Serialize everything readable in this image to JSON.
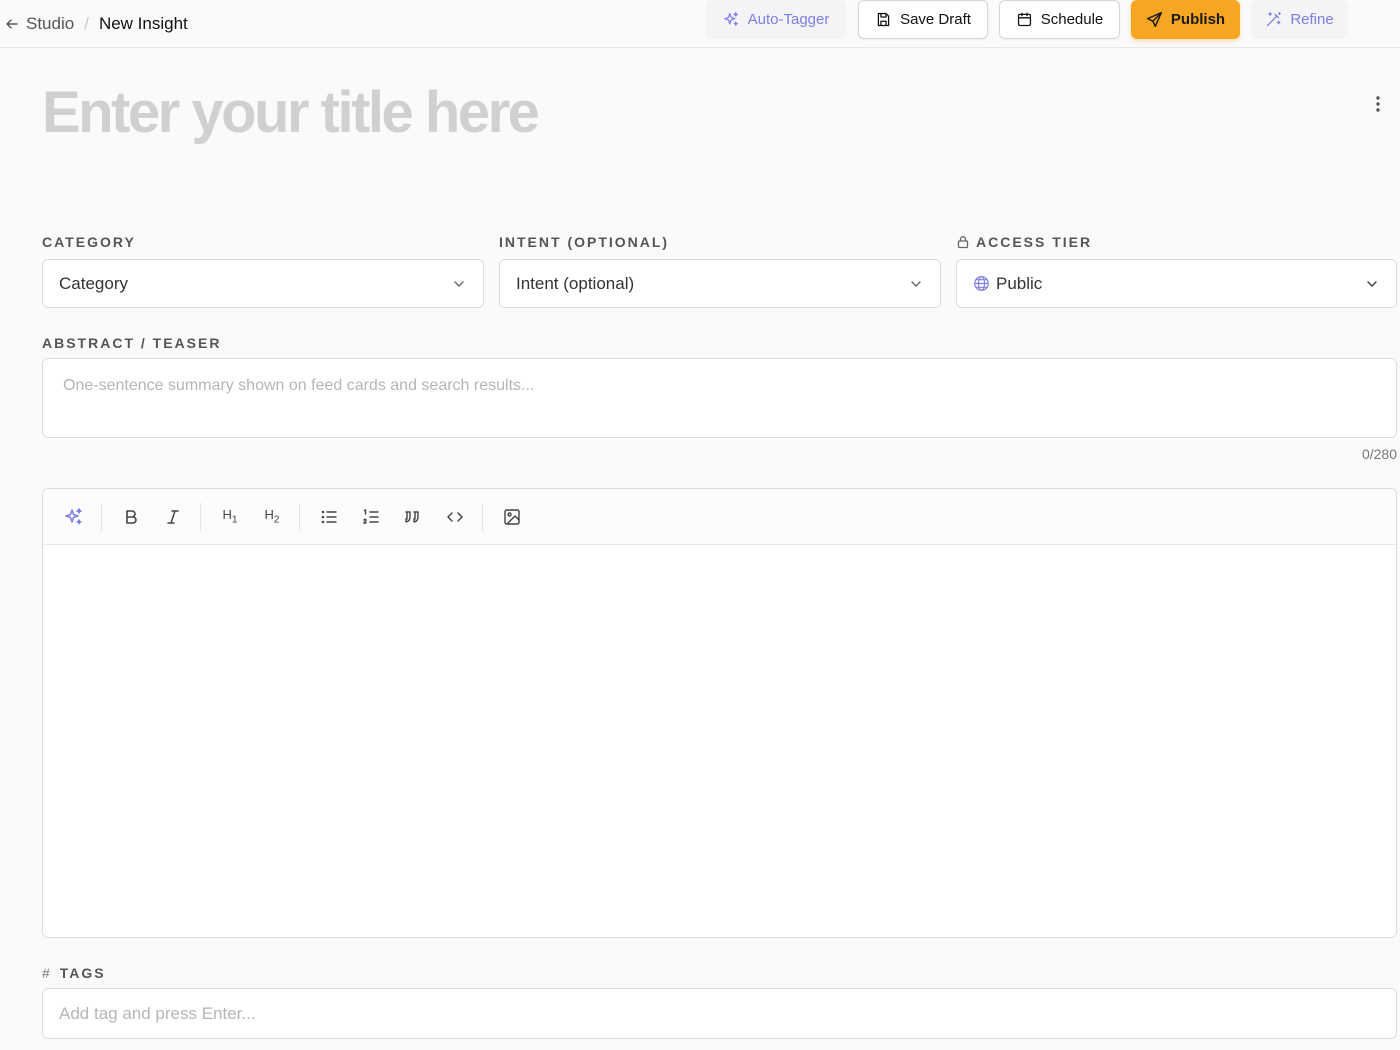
{
  "breadcrumb": {
    "parent": "Studio",
    "separator": "/",
    "current": "New Insight"
  },
  "title_input": {
    "placeholder": "Enter your title here"
  },
  "actions": {
    "auto_tagger": "Auto-Tagger",
    "save_draft": "Save Draft",
    "schedule": "Schedule",
    "publish": "Publish",
    "refine": "Refine"
  },
  "fields": {
    "category": {
      "label": "Category",
      "value": "Category"
    },
    "intent": {
      "label": "Intent (optional)",
      "value": "Intent (optional)"
    },
    "access_tier": {
      "label": "Access Tier",
      "value": "Public"
    }
  },
  "teaser": {
    "label": "Abstract / Teaser",
    "placeholder": "One-sentence summary shown on feed cards and search results...",
    "counter": "0/280"
  },
  "editor": {
    "toolbar": [
      "ai-sparkle",
      "bold",
      "italic",
      "heading-1",
      "heading-2",
      "bullet-list",
      "numbered-list",
      "quote",
      "code",
      "image"
    ],
    "h1_label": "H",
    "h1_sub": "1",
    "h2_label": "H",
    "h2_sub": "2"
  },
  "tags": {
    "label": "Tags",
    "hash": "#",
    "placeholder": "Add tag and press Enter..."
  },
  "colors": {
    "accent": "#7b7ee0",
    "primary": "#f6a623",
    "border": "#dcdcdc",
    "background": "#fafafa"
  }
}
